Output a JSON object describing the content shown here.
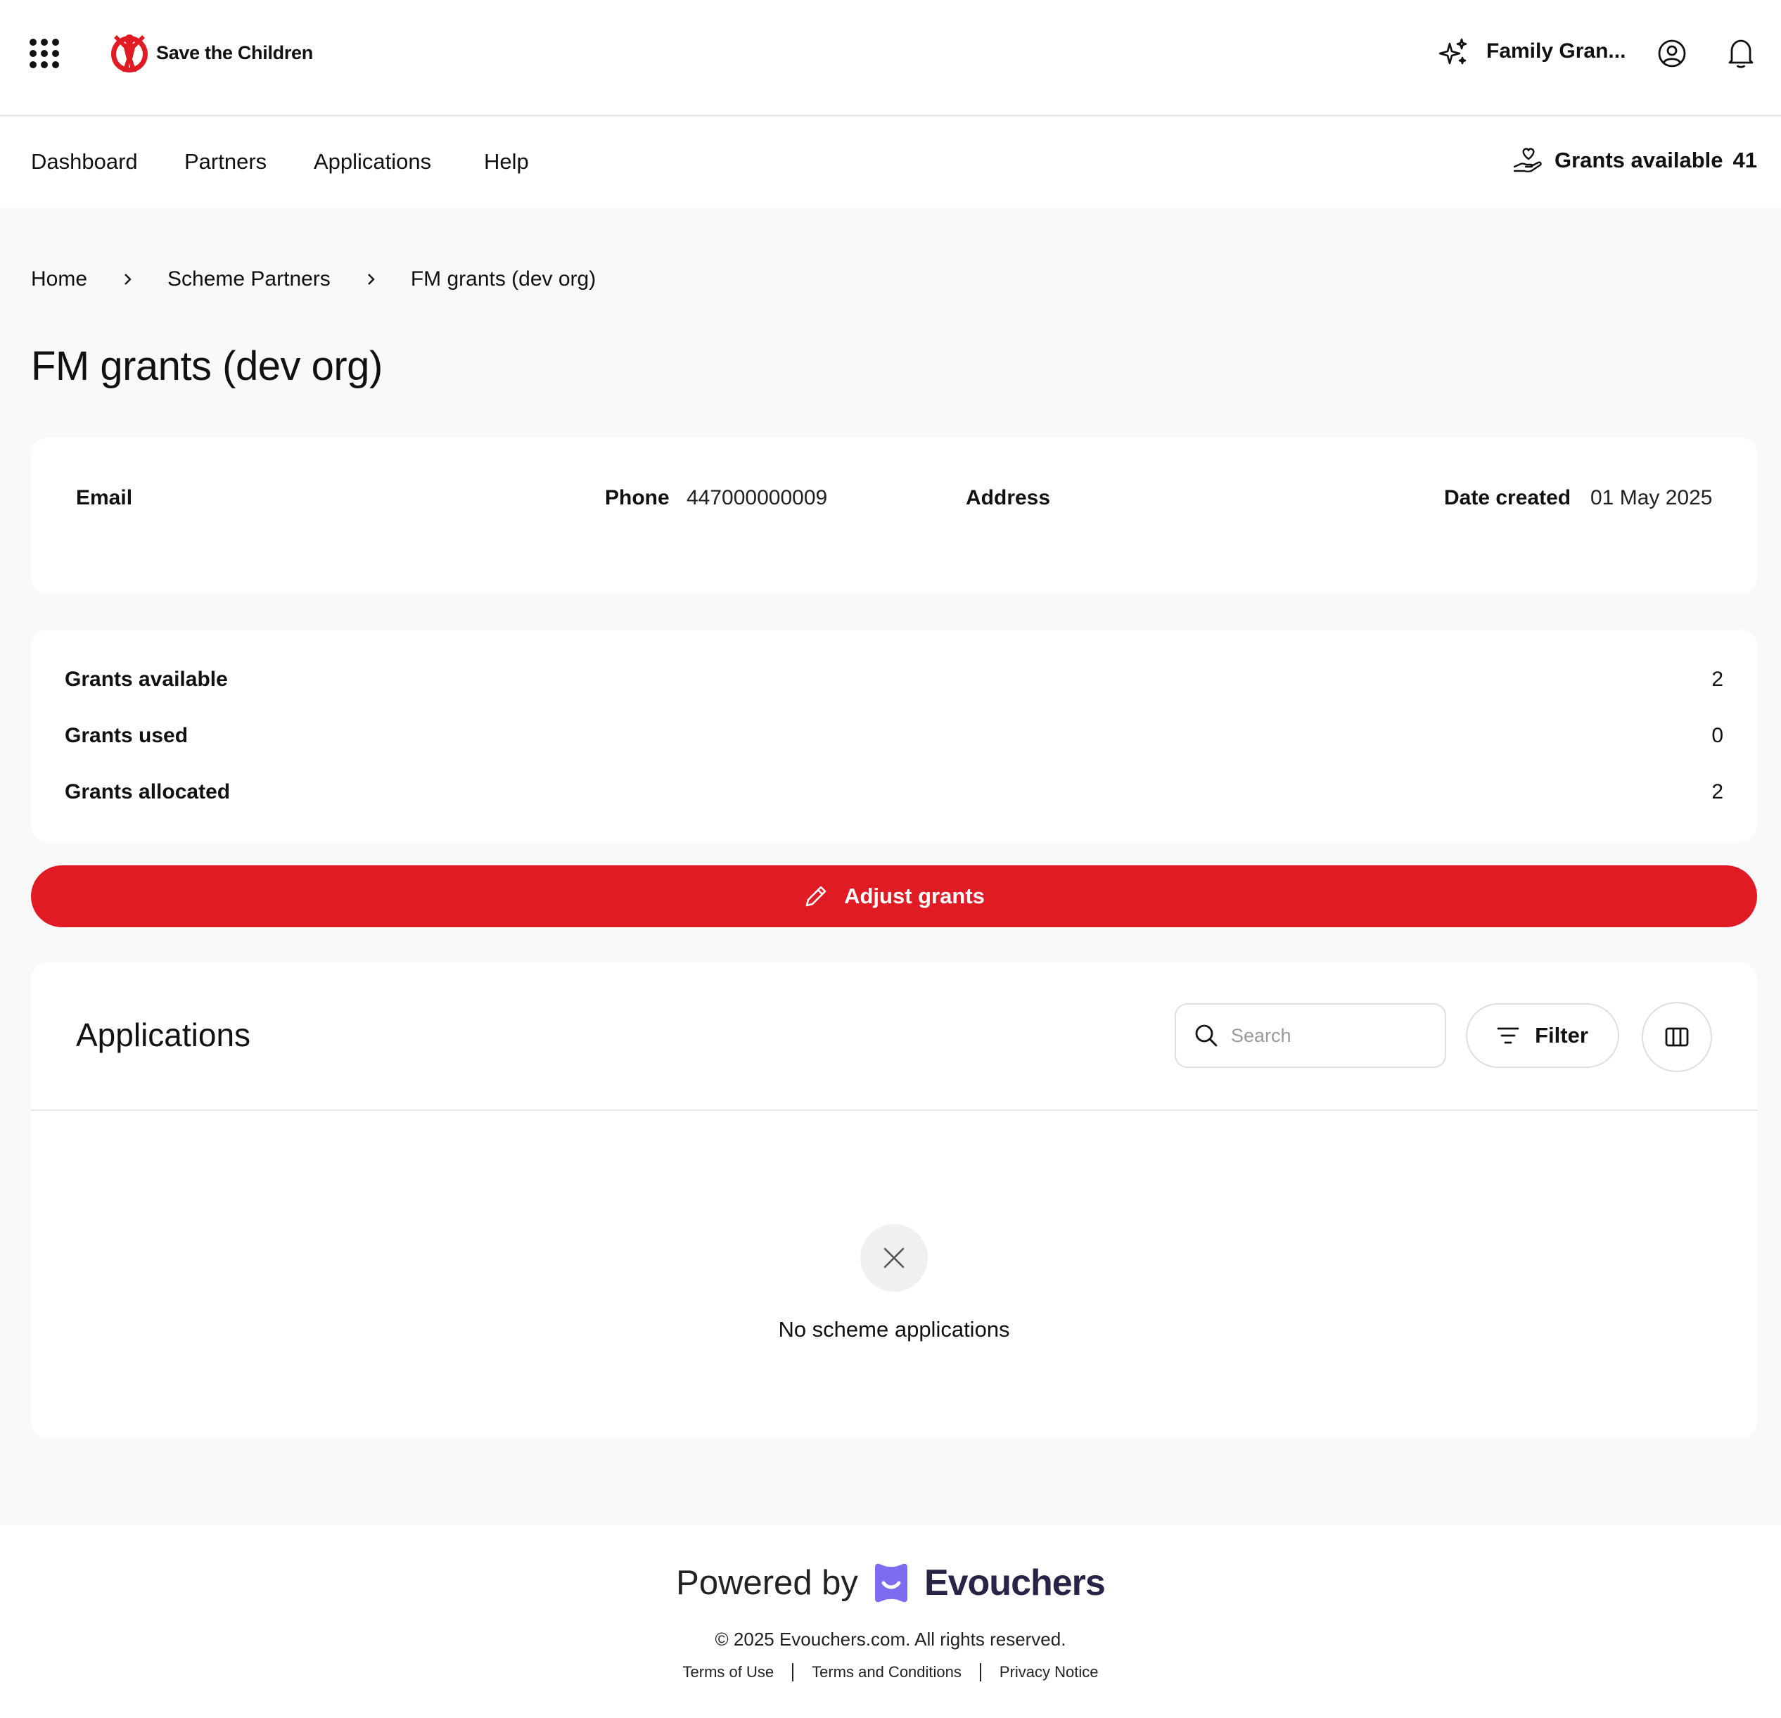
{
  "header": {
    "logo_text": "Save the Children",
    "org_name": "Family Gran...",
    "icons": [
      "apps-grid-icon",
      "sparkle-icon",
      "user-icon",
      "bell-icon"
    ]
  },
  "nav": {
    "items": [
      {
        "label": "Dashboard"
      },
      {
        "label": "Partners"
      },
      {
        "label": "Applications"
      },
      {
        "label": "Help"
      }
    ],
    "grants_label": "Grants available",
    "grants_count": "41"
  },
  "breadcrumb": {
    "items": [
      "Home",
      "Scheme Partners",
      "FM grants (dev org)"
    ]
  },
  "page": {
    "title": "FM grants (dev org)"
  },
  "info": {
    "email_label": "Email",
    "email_value": "",
    "phone_label": "Phone",
    "phone_value": "447000000009",
    "address_label": "Address",
    "address_value": "",
    "date_label": "Date created",
    "date_value": "01 May 2025"
  },
  "stats": [
    {
      "label": "Grants available",
      "value": "2"
    },
    {
      "label": "Grants used",
      "value": "0"
    },
    {
      "label": "Grants allocated",
      "value": "2"
    }
  ],
  "actions": {
    "adjust_label": "Adjust grants"
  },
  "applications": {
    "title": "Applications",
    "search_placeholder": "Search",
    "search_value": "",
    "filter_label": "Filter",
    "empty_text": "No scheme applications"
  },
  "footer": {
    "powered_by": "Powered by",
    "brand": "Evouchers",
    "copyright": "© 2025 Evouchers.com. All rights reserved.",
    "links": [
      "Terms of Use",
      "Terms and Conditions",
      "Privacy Notice"
    ]
  },
  "colors": {
    "accent_red": "#e01b24",
    "brand_purple": "#7b6cf0",
    "brand_text": "#2a2347",
    "page_bg": "#f9f9f9"
  }
}
